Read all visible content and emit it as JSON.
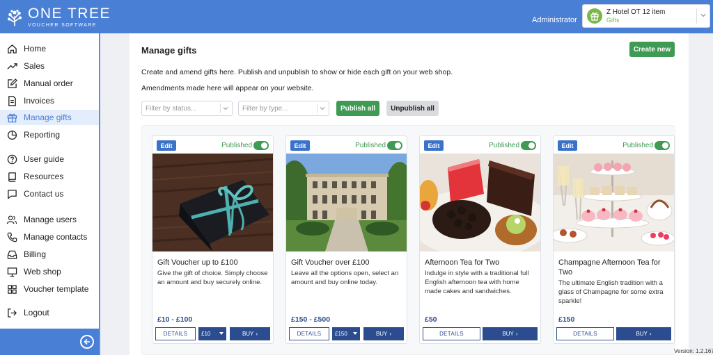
{
  "header": {
    "brand_name": "ONE TREE",
    "brand_sub": "VOUCHER SOFTWARE",
    "user_role": "Administrator",
    "hotel_select": {
      "name": "Z Hotel OT 12 item",
      "sub": "Gifts"
    }
  },
  "sidebar": {
    "items": [
      {
        "label": "Home",
        "icon": "home-icon"
      },
      {
        "label": "Sales",
        "icon": "trend-icon"
      },
      {
        "label": "Manual order",
        "icon": "edit-icon"
      },
      {
        "label": "Invoices",
        "icon": "document-icon"
      },
      {
        "label": "Manage gifts",
        "icon": "gift-icon"
      },
      {
        "label": "Reporting",
        "icon": "pie-chart-icon"
      },
      {
        "label": "User guide",
        "icon": "help-icon"
      },
      {
        "label": "Resources",
        "icon": "book-icon"
      },
      {
        "label": "Contact us",
        "icon": "chat-icon"
      },
      {
        "label": "Manage users",
        "icon": "users-icon"
      },
      {
        "label": "Manage contacts",
        "icon": "phone-icon"
      },
      {
        "label": "Billing",
        "icon": "inbox-icon"
      },
      {
        "label": "Web shop",
        "icon": "monitor-icon"
      },
      {
        "label": "Voucher template",
        "icon": "grid-icon"
      },
      {
        "label": "Logout",
        "icon": "logout-icon"
      }
    ],
    "active": "Manage gifts"
  },
  "main": {
    "title": "Manage gifts",
    "create_label": "Create new",
    "description_1": "Create and amend gifts here. Publish and unpublish to show or hide each gift on your web shop.",
    "description_2": "Amendments made here will appear on your website.",
    "filter_status_placeholder": "Filter by status...",
    "filter_type_placeholder": "Filter by type...",
    "publish_all_label": "Publish all",
    "unpublish_all_label": "Unpublish all"
  },
  "gifts": [
    {
      "edit": "Edit",
      "status": "Published",
      "title": "Gift Voucher up to £100",
      "description": "Give the gift of choice. Simply choose an amount and buy securely online.",
      "price": "£10 - £100",
      "details": "DETAILS",
      "amount": "£10",
      "buy": "BUY"
    },
    {
      "edit": "Edit",
      "status": "Published",
      "title": "Gift Voucher over £100",
      "description": "Leave all the options open, select an amount and buy online today.",
      "price": "£150 - £500",
      "details": "DETAILS",
      "amount": "£150",
      "buy": "BUY"
    },
    {
      "edit": "Edit",
      "status": "Published",
      "title": "Afternoon Tea for Two",
      "description": "Indulge in style with a traditional full English afternoon tea with home made cakes and sandwiches.",
      "price": "£50",
      "details": "DETAILS",
      "buy": "BUY"
    },
    {
      "edit": "Edit",
      "status": "Published",
      "title": "Champagne Afternoon Tea for Two",
      "description": "The ultimate English tradition with a glass of Champagne for some extra sparkle!",
      "price": "£150",
      "details": "DETAILS",
      "buy": "BUY"
    }
  ],
  "footer": {
    "version": "Version: 1.2.167"
  },
  "colors": {
    "primary": "#4a7fd6",
    "success": "#3f9a54",
    "navy": "#2b4d8f",
    "accent_green": "#7ab648"
  }
}
